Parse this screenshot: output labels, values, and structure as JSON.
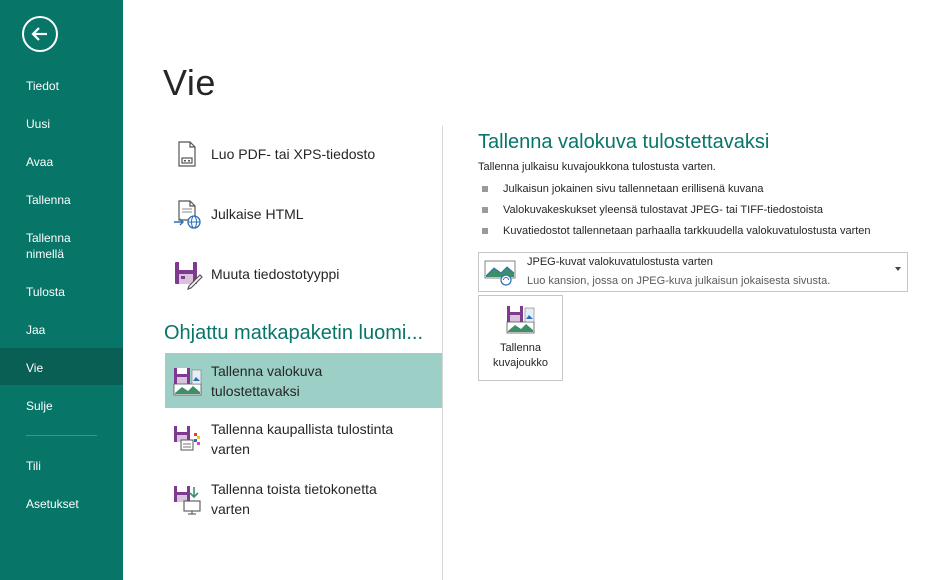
{
  "sidebar": {
    "back_icon": "back-arrow-icon",
    "items": [
      {
        "label": "Tiedot",
        "selected": false
      },
      {
        "label": "Uusi",
        "selected": false
      },
      {
        "label": "Avaa",
        "selected": false
      },
      {
        "label": "Tallenna",
        "selected": false
      },
      {
        "label": "Tallenna nimellä",
        "selected": false
      },
      {
        "label": "Tulosta",
        "selected": false
      },
      {
        "label": "Jaa",
        "selected": false
      },
      {
        "label": "Vie",
        "selected": true
      },
      {
        "label": "Sulje",
        "selected": false
      },
      {
        "label": "Tili",
        "selected": false
      },
      {
        "label": "Asetukset",
        "selected": false
      }
    ]
  },
  "page": {
    "title": "Vie"
  },
  "options": [
    {
      "label": "Luo PDF- tai XPS-tiedosto",
      "icon": "pdf-xps-document-icon"
    },
    {
      "label": "Julkaise HTML",
      "icon": "publish-html-icon"
    },
    {
      "label": "Muuta tiedostotyyppi",
      "icon": "change-file-type-icon"
    }
  ],
  "pack_section": {
    "heading": "Ohjattu matkapaketin luomi...",
    "items": [
      {
        "label_line1": "Tallenna valokuva",
        "label_line2": "tulostettavaksi",
        "icon": "save-photo-icon",
        "selected": true
      },
      {
        "label_line1": "Tallenna kaupallista tulostinta",
        "label_line2": "varten",
        "icon": "save-commercial-printer-icon",
        "selected": false
      },
      {
        "label_line1": "Tallenna toista tietokonetta",
        "label_line2": "varten",
        "icon": "save-other-computer-icon",
        "selected": false
      }
    ]
  },
  "panel": {
    "title": "Tallenna valokuva tulostettavaksi",
    "description": "Tallenna julkaisu kuvajoukkona tulostusta varten.",
    "bullets": [
      "Julkaisun jokainen sivu tallennetaan erillisenä kuvana",
      "Valokuvakeskukset yleensä tulostavat JPEG- tai TIFF-tiedostoista",
      "Kuvatiedostot tallennetaan parhaalla tarkkuudella valokuvatulostusta varten"
    ],
    "dropdown": {
      "title": "JPEG-kuvat valokuvatulostusta varten",
      "subtitle": "Luo kansion, jossa on JPEG-kuva julkaisun jokaisesta sivusta."
    },
    "button": {
      "line1": "Tallenna",
      "line2": "kuvajoukko"
    }
  },
  "colors": {
    "sidebar": "#077568",
    "accent": "#077568",
    "selected_option": "#9ccfc6",
    "publisher_purple": "#7e3a8f"
  }
}
